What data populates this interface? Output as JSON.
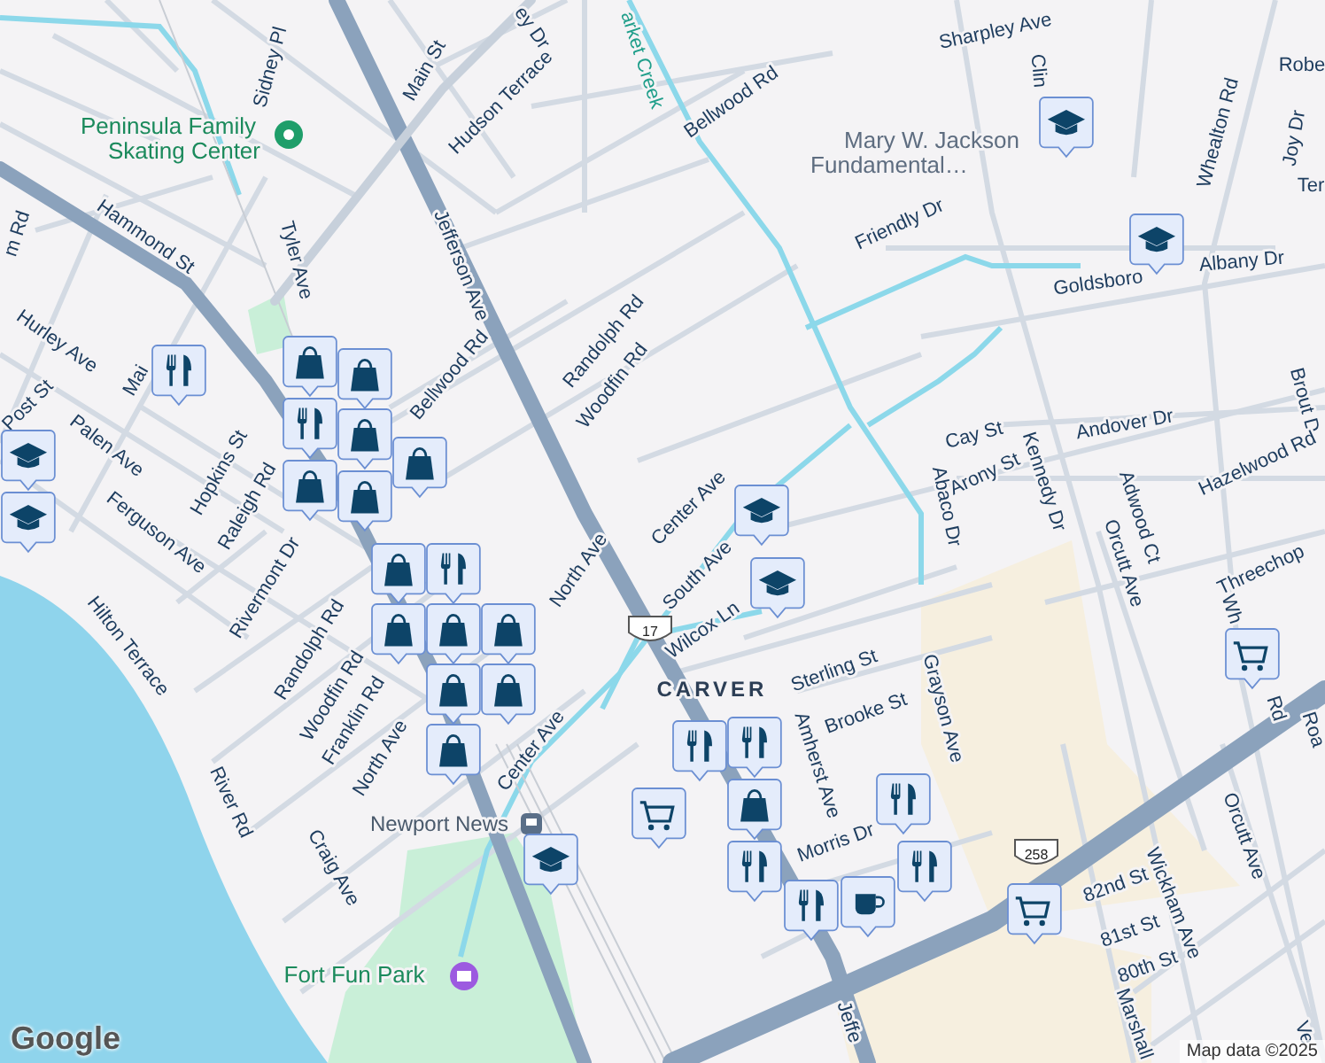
{
  "labels": [
    {
      "text": "Sidney Pl",
      "kind": "street"
    },
    {
      "text": "Main St",
      "kind": "street"
    },
    {
      "text": "Hudson Terrace",
      "kind": "street"
    },
    {
      "text": "ey Dr",
      "kind": "street"
    },
    {
      "text": "arket Creek",
      "kind": "water"
    },
    {
      "text": "Bellwood Rd",
      "kind": "street"
    },
    {
      "text": "Sharpley Ave",
      "kind": "street"
    },
    {
      "text": "Clin",
      "kind": "street"
    },
    {
      "text": "Robe",
      "kind": "street"
    },
    {
      "text": "Joy Dr",
      "kind": "street"
    },
    {
      "text": "Ter",
      "kind": "street"
    },
    {
      "text": "Whealton Rd",
      "kind": "street"
    },
    {
      "text": "Friendly Dr",
      "kind": "street"
    },
    {
      "text": "Goldsboro",
      "kind": "street"
    },
    {
      "text": "Albany Dr",
      "kind": "street"
    },
    {
      "text": "Brout D",
      "kind": "street"
    },
    {
      "text": "Andover Dr",
      "kind": "street"
    },
    {
      "text": "Hazelwood Rd",
      "kind": "street"
    },
    {
      "text": "Cay St",
      "kind": "street"
    },
    {
      "text": "Arony St",
      "kind": "street"
    },
    {
      "text": "Kennedy Dr",
      "kind": "street"
    },
    {
      "text": "Abaco Dr",
      "kind": "street"
    },
    {
      "text": "Adwood Ct",
      "kind": "street"
    },
    {
      "text": "Orcutt Ave",
      "kind": "street"
    },
    {
      "text": "Threechop",
      "kind": "street"
    },
    {
      "text": "Wh",
      "kind": "street"
    },
    {
      "text": "Rd",
      "kind": "street"
    },
    {
      "text": "Roa",
      "kind": "street"
    },
    {
      "text": "Orcutt Ave",
      "kind": "street"
    },
    {
      "text": "Wickham Ave",
      "kind": "street"
    },
    {
      "text": "82nd St",
      "kind": "street"
    },
    {
      "text": "81st St",
      "kind": "street"
    },
    {
      "text": "80th St",
      "kind": "street"
    },
    {
      "text": "Marshall",
      "kind": "street"
    },
    {
      "text": "Ve",
      "kind": "street"
    },
    {
      "text": "Jeffe",
      "kind": "street"
    },
    {
      "text": "Grayson Ave",
      "kind": "street"
    },
    {
      "text": "Sterling St",
      "kind": "street"
    },
    {
      "text": "Brooke St",
      "kind": "street"
    },
    {
      "text": "Amherst Ave",
      "kind": "street"
    },
    {
      "text": "Morris Dr",
      "kind": "street"
    },
    {
      "text": "CARVER",
      "kind": "district"
    },
    {
      "text": "Wilcox Ln",
      "kind": "street"
    },
    {
      "text": "South Ave",
      "kind": "street"
    },
    {
      "text": "Center Ave",
      "kind": "street"
    },
    {
      "text": "North Ave",
      "kind": "street"
    },
    {
      "text": "Jefferson Ave",
      "kind": "street"
    },
    {
      "text": "Randolph Rd",
      "kind": "street"
    },
    {
      "text": "Woodfin Rd",
      "kind": "street"
    },
    {
      "text": "Bellwood Rd",
      "kind": "street"
    },
    {
      "text": "Tyler Ave",
      "kind": "street"
    },
    {
      "text": "Hammond St",
      "kind": "street"
    },
    {
      "text": "Hurley Ave",
      "kind": "street"
    },
    {
      "text": "Post St",
      "kind": "street"
    },
    {
      "text": "Mai",
      "kind": "street"
    },
    {
      "text": "Hopkins St",
      "kind": "street"
    },
    {
      "text": "Raleigh Rd",
      "kind": "street"
    },
    {
      "text": "Palen Ave",
      "kind": "street"
    },
    {
      "text": "Ferguson Ave",
      "kind": "street"
    },
    {
      "text": "Rivermont Dr",
      "kind": "street"
    },
    {
      "text": "Hilton Terrace",
      "kind": "street"
    },
    {
      "text": "Randolph Rd",
      "kind": "street"
    },
    {
      "text": "Woodfin Rd",
      "kind": "street"
    },
    {
      "text": "Franklin Rd",
      "kind": "street"
    },
    {
      "text": "North Ave",
      "kind": "street"
    },
    {
      "text": "Center Ave",
      "kind": "street"
    },
    {
      "text": "River Rd",
      "kind": "street"
    },
    {
      "text": "Craig Ave",
      "kind": "street"
    },
    {
      "text": "m Rd",
      "kind": "street"
    },
    {
      "text": "Newport News",
      "kind": "transit"
    },
    {
      "text": "Fort Fun Park",
      "kind": "park"
    },
    {
      "text": "Peninsula Family",
      "kind": "park"
    },
    {
      "text": "Skating Center",
      "kind": "park"
    },
    {
      "text": "Mary W. Jackson",
      "kind": "school"
    },
    {
      "text": "Fundamental…",
      "kind": "school"
    }
  ],
  "route_shields": [
    "17",
    "258"
  ],
  "markers": [
    {
      "kind": "school"
    },
    {
      "kind": "school"
    },
    {
      "kind": "school"
    },
    {
      "kind": "school"
    },
    {
      "kind": "restaurant"
    },
    {
      "kind": "shopping"
    },
    {
      "kind": "shopping"
    },
    {
      "kind": "restaurant"
    },
    {
      "kind": "shopping"
    },
    {
      "kind": "shopping"
    },
    {
      "kind": "shopping"
    },
    {
      "kind": "shopping"
    },
    {
      "kind": "shopping"
    },
    {
      "kind": "restaurant"
    },
    {
      "kind": "shopping"
    },
    {
      "kind": "shopping"
    },
    {
      "kind": "shopping"
    },
    {
      "kind": "shopping"
    },
    {
      "kind": "shopping"
    },
    {
      "kind": "shopping"
    },
    {
      "kind": "school"
    },
    {
      "kind": "school"
    },
    {
      "kind": "grocery"
    },
    {
      "kind": "grocery"
    },
    {
      "kind": "grocery"
    },
    {
      "kind": "restaurant"
    },
    {
      "kind": "restaurant"
    },
    {
      "kind": "shopping"
    },
    {
      "kind": "restaurant"
    },
    {
      "kind": "restaurant"
    },
    {
      "kind": "restaurant"
    },
    {
      "kind": "cafe"
    },
    {
      "kind": "restaurant"
    },
    {
      "kind": "school"
    }
  ],
  "logo": "Google",
  "attribution": "Map data ©2025"
}
